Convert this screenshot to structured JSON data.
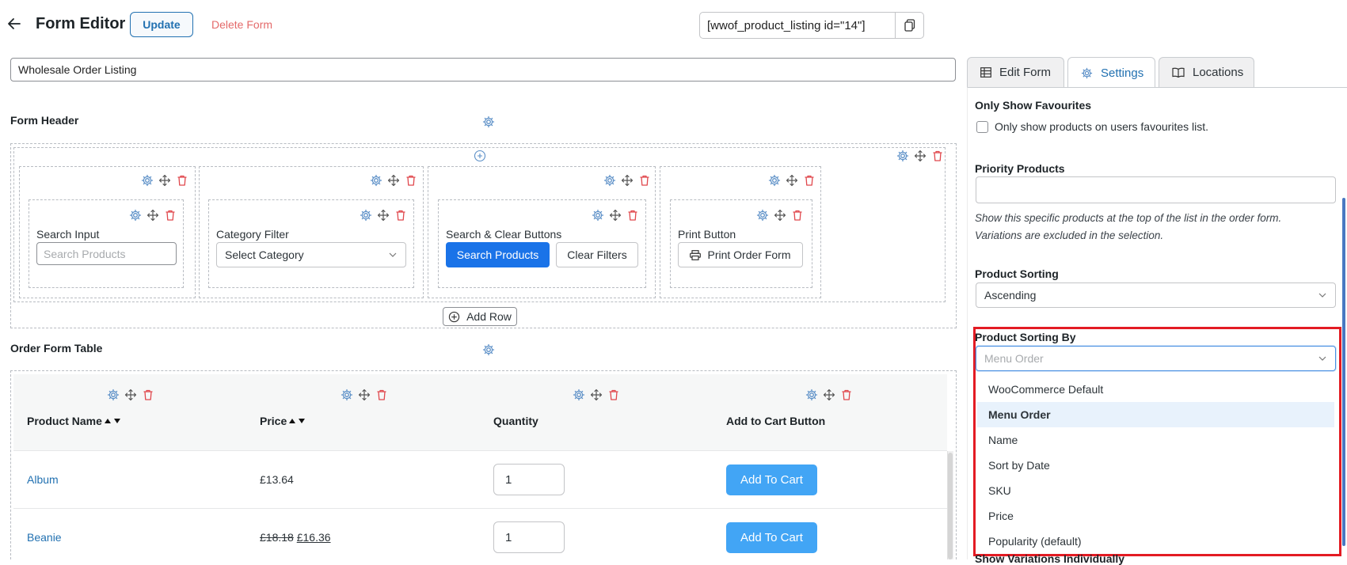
{
  "header": {
    "title": "Form Editor",
    "update_label": "Update",
    "delete_label": "Delete Form",
    "shortcode": "[wwof_product_listing id=\"14\"]"
  },
  "form_name": "Wholesale Order Listing",
  "tabs": [
    {
      "label": "Edit Form",
      "icon": "table-icon"
    },
    {
      "label": "Settings",
      "icon": "gear-icon"
    },
    {
      "label": "Locations",
      "icon": "book-icon"
    }
  ],
  "settings": {
    "favourites": {
      "title": "Only Show Favourites",
      "checkbox_label": "Only show products on users favourites list.",
      "checked": false
    },
    "priority": {
      "title": "Priority Products",
      "value": "",
      "help_line1": "Show this specific products at the top of the list in the order form.",
      "help_line2": "Variations are excluded in the selection."
    },
    "sorting": {
      "title": "Product Sorting",
      "value": "Ascending"
    },
    "sorting_by": {
      "title": "Product Sorting By",
      "placeholder": "Menu Order",
      "options": [
        "WooCommerce Default",
        "Menu Order",
        "Name",
        "Sort by Date",
        "SKU",
        "Price",
        "Popularity (default)"
      ],
      "selected_index": 1
    },
    "next_title_partial": "Show Variations Individually"
  },
  "form_header": {
    "title": "Form Header",
    "columns": [
      {
        "label": "Search Input",
        "input_placeholder": "Search Products"
      },
      {
        "label": "Category Filter",
        "select_value": "Select Category"
      },
      {
        "label": "Search & Clear Buttons",
        "primary_button": "Search Products",
        "secondary_button": "Clear Filters"
      },
      {
        "label": "Print Button",
        "button": "Print Order Form"
      }
    ],
    "add_row_label": "Add Row"
  },
  "order_table": {
    "title": "Order Form Table",
    "columns": [
      "Product Name",
      "Price",
      "Quantity",
      "Add to Cart Button"
    ],
    "rows": [
      {
        "name": "Album",
        "price": "£13.64",
        "old_price": "",
        "quantity": "1",
        "button": "Add To Cart"
      },
      {
        "name": "Beanie",
        "price": "£16.36",
        "old_price": "£18.18",
        "quantity": "1",
        "button": "Add To Cart"
      }
    ]
  },
  "colors": {
    "accent": "#2271b1",
    "danger": "#e46a6a",
    "highlight": "#e31b23",
    "primary_button": "#1a73e8",
    "cart_button": "#42a5f5"
  }
}
